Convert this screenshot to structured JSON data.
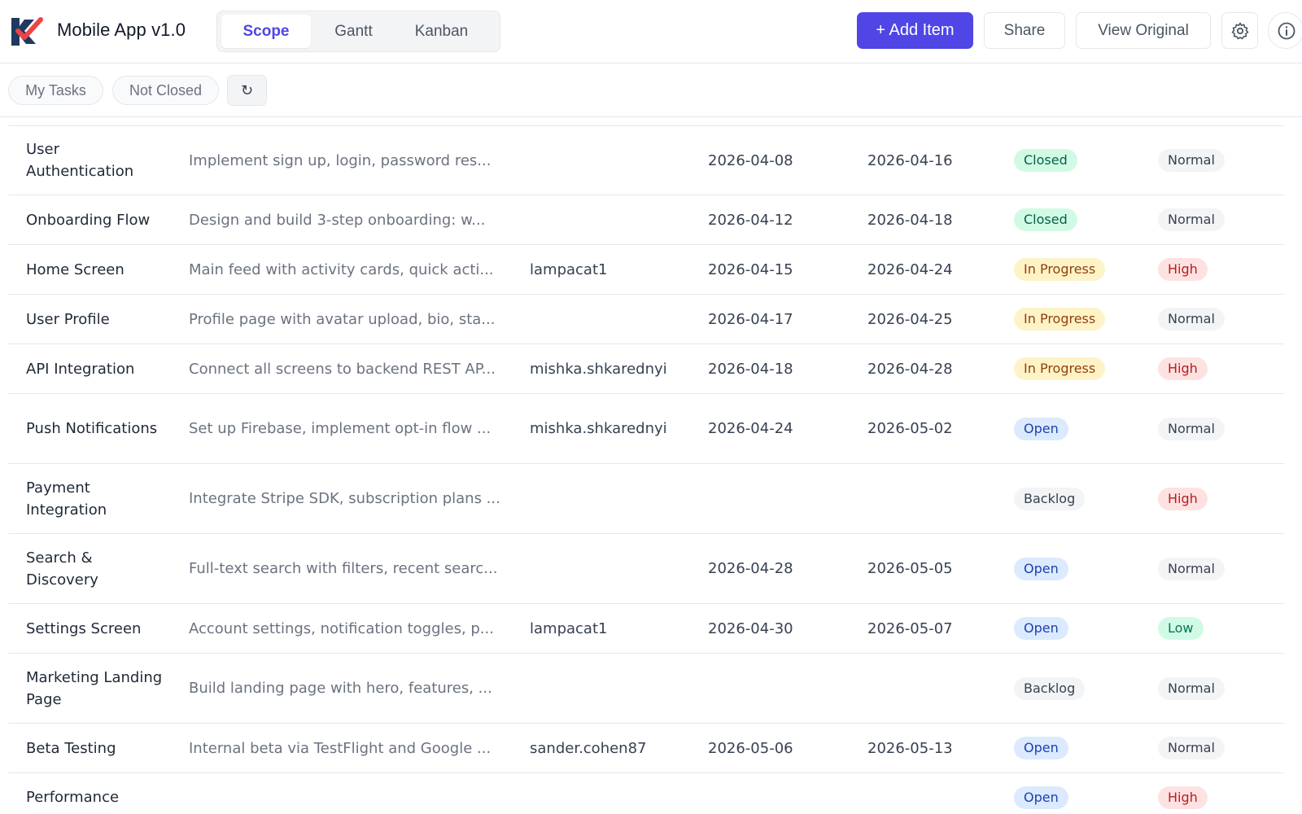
{
  "header": {
    "app_title": "Mobile App v1.0",
    "tabs": [
      {
        "label": "Scope",
        "active": true
      },
      {
        "label": "Gantt",
        "active": false
      },
      {
        "label": "Kanban",
        "active": false
      }
    ],
    "add_item_label": "+ Add Item",
    "share_label": "Share",
    "view_original_label": "View Original",
    "accent_color": "#4f46e5"
  },
  "filters": {
    "chips": [
      "My Tasks",
      "Not Closed"
    ],
    "refresh_symbol": "↻"
  },
  "rows": [
    {
      "name": "User Authentication",
      "description": "Implement sign up, login, password res...",
      "assignee": "",
      "start": "2026-04-08",
      "end": "2026-04-16",
      "status": "Closed",
      "priority": "Normal"
    },
    {
      "name": "Onboarding Flow",
      "description": "Design and build 3-step onboarding: w...",
      "assignee": "",
      "start": "2026-04-12",
      "end": "2026-04-18",
      "status": "Closed",
      "priority": "Normal"
    },
    {
      "name": "Home Screen",
      "description": "Main feed with activity cards, quick acti...",
      "assignee": "lampacat1",
      "start": "2026-04-15",
      "end": "2026-04-24",
      "status": "In Progress",
      "priority": "High"
    },
    {
      "name": "User Profile",
      "description": "Profile page with avatar upload, bio, sta...",
      "assignee": "",
      "start": "2026-04-17",
      "end": "2026-04-25",
      "status": "In Progress",
      "priority": "Normal"
    },
    {
      "name": "API Integration",
      "description": "Connect all screens to backend REST AP...",
      "assignee": "mishka.shkarednyi",
      "start": "2026-04-18",
      "end": "2026-04-28",
      "status": "In Progress",
      "priority": "High"
    },
    {
      "name": "Push Notifications",
      "description": "Set up Firebase, implement opt-in flow ...",
      "assignee": "mishka.shkarednyi",
      "start": "2026-04-24",
      "end": "2026-05-02",
      "status": "Open",
      "priority": "Normal"
    },
    {
      "name": "Payment Integration",
      "description": "Integrate Stripe SDK, subscription plans ...",
      "assignee": "",
      "start": "",
      "end": "",
      "status": "Backlog",
      "priority": "High"
    },
    {
      "name": "Search & Discovery",
      "description": "Full-text search with filters, recent searc...",
      "assignee": "",
      "start": "2026-04-28",
      "end": "2026-05-05",
      "status": "Open",
      "priority": "Normal"
    },
    {
      "name": "Settings Screen",
      "description": "Account settings, notification toggles, p...",
      "assignee": "lampacat1",
      "start": "2026-04-30",
      "end": "2026-05-07",
      "status": "Open",
      "priority": "Low"
    },
    {
      "name": "Marketing Landing Page",
      "description": "Build landing page with hero, features, ...",
      "assignee": "",
      "start": "",
      "end": "",
      "status": "Backlog",
      "priority": "Normal"
    },
    {
      "name": "Beta Testing",
      "description": "Internal beta via TestFlight and Google ...",
      "assignee": "sander.cohen87",
      "start": "2026-05-06",
      "end": "2026-05-13",
      "status": "Open",
      "priority": "Normal"
    },
    {
      "name": "Performance",
      "description": "",
      "assignee": "",
      "start": "",
      "end": "",
      "status": "Open",
      "priority": "High"
    }
  ]
}
